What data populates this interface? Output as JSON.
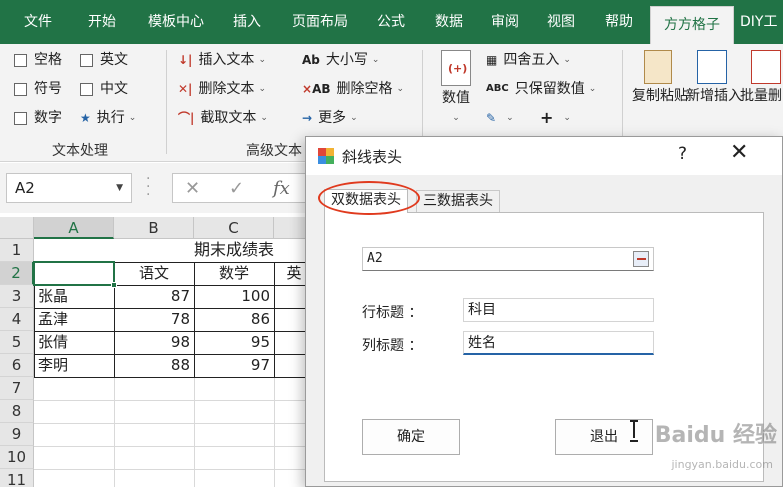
{
  "ribbon_tabs": [
    "文件",
    "开始",
    "模板中心",
    "插入",
    "页面布局",
    "公式",
    "数据",
    "审阅",
    "视图",
    "帮助",
    "方方格子",
    "DIY工"
  ],
  "active_tab": "方方格子",
  "ribbon": {
    "text_group": {
      "checkboxes": [
        "空格",
        "英文",
        "符号",
        "中文",
        "数字"
      ],
      "execute": "执行",
      "name": "文本处理"
    },
    "advanced_text_group": {
      "items": [
        "插入文本",
        "删除文本",
        "截取文本",
        "大小写",
        "删除空格",
        "更多"
      ],
      "name": "高级文本"
    },
    "numeric_group": {
      "value_label": "数值",
      "items": [
        "四舍五入",
        "只保留数值"
      ]
    },
    "edit_group": {
      "buttons": [
        "复制粘贴",
        "新增插入",
        "批量删除"
      ]
    }
  },
  "formula_bar": {
    "name_box": "A2",
    "fx": "fx"
  },
  "sheet": {
    "columns": [
      "A",
      "B",
      "C"
    ],
    "rows": [
      "1",
      "2",
      "3",
      "4",
      "5",
      "6",
      "7",
      "8",
      "9",
      "10",
      "11"
    ],
    "title": "期末成绩表",
    "header_row": [
      "",
      "语文",
      "数学",
      "英"
    ],
    "data": [
      {
        "name": "张晶",
        "chinese": "87",
        "math": "100"
      },
      {
        "name": "孟津",
        "chinese": "78",
        "math": "86"
      },
      {
        "name": "张倩",
        "chinese": "98",
        "math": "95"
      },
      {
        "name": "李明",
        "chinese": "88",
        "math": "97"
      }
    ]
  },
  "dialog": {
    "title": "斜线表头",
    "help": "?",
    "close": "✕",
    "tabs": [
      "双数据表头",
      "三数据表头"
    ],
    "ref_value": "A2",
    "row_title_label": "行标题 ：",
    "row_title_value": "科目",
    "col_title_label": "列标题 ：",
    "col_title_value": "姓名",
    "ok_button": "确定",
    "exit_button": "退出"
  },
  "watermark": {
    "brand": "Baidu 经验",
    "url": "jingyan.baidu.com"
  }
}
